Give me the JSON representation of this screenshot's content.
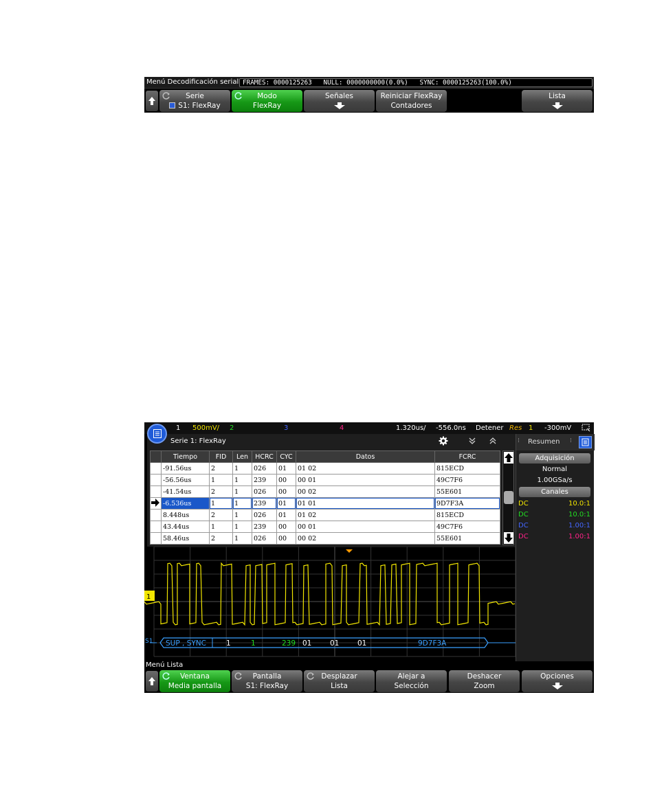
{
  "menu1": {
    "title": "Menú Decodificación serial",
    "stats": "FRAMES: 0000125263   NULL: 0000000000(0.0%)   SYNC: 0000125263(100.0%)",
    "softkeys": [
      {
        "line1": "Serie",
        "line2": "S1: FlexRay"
      },
      {
        "line1": "Modo",
        "line2": "FlexRay"
      },
      {
        "line1": "Señales"
      },
      {
        "line1": "Reiniciar FlexRay",
        "line2": "Contadores"
      },
      {
        "line1": ""
      },
      {
        "line1": "Lista"
      }
    ]
  },
  "statusbar": {
    "ch1": "1",
    "ch1_scale": "500mV/",
    "ch2": "2",
    "ch3": "3",
    "ch4": "4",
    "timebase": "1.320us/",
    "delay": "-556.0ns",
    "run_state": "Detener",
    "trigger_label": "Res",
    "trigger_ch": "1",
    "trigger_level": "-300mV"
  },
  "list": {
    "title": "Serie 1: FlexRay",
    "headers": [
      "Tiempo",
      "FID",
      "Len",
      "HCRC",
      "CYC",
      "Datos",
      "FCRC"
    ],
    "rows": [
      {
        "tiempo": "-91.56us",
        "fid": "2",
        "len": "1",
        "hcrc": "026",
        "cyc": "01",
        "datos": "01 02",
        "fcrc": "815ECD"
      },
      {
        "tiempo": "-56.56us",
        "fid": "1",
        "len": "1",
        "hcrc": "239",
        "cyc": "00",
        "datos": "00 01",
        "fcrc": "49C7F6"
      },
      {
        "tiempo": "-41.54us",
        "fid": "2",
        "len": "1",
        "hcrc": "026",
        "cyc": "00",
        "datos": "00 02",
        "fcrc": "55E601"
      },
      {
        "tiempo": "-6.536us",
        "fid": "1",
        "len": "1",
        "hcrc": "239",
        "cyc": "01",
        "datos": "01 01",
        "fcrc": "9D7F3A"
      },
      {
        "tiempo": "8.448us",
        "fid": "2",
        "len": "1",
        "hcrc": "026",
        "cyc": "01",
        "datos": "01 02",
        "fcrc": "815ECD"
      },
      {
        "tiempo": "43.44us",
        "fid": "1",
        "len": "1",
        "hcrc": "239",
        "cyc": "00",
        "datos": "00 01",
        "fcrc": "49C7F6"
      },
      {
        "tiempo": "58.46us",
        "fid": "2",
        "len": "1",
        "hcrc": "026",
        "cyc": "00",
        "datos": "00 02",
        "fcrc": "55E601"
      }
    ]
  },
  "side": {
    "tab": "Resumen",
    "acq_header": "Adquisición",
    "acq_mode": "Normal",
    "acq_rate": "1.00GSa/s",
    "channels_header": "Canales",
    "channels": [
      {
        "coupling": "DC",
        "probe": "10.0:1",
        "color": "#f2e600"
      },
      {
        "coupling": "DC",
        "probe": "10.0:1",
        "color": "#22dd22"
      },
      {
        "coupling": "DC",
        "probe": "1.00:1",
        "color": "#4466ff"
      },
      {
        "coupling": "DC",
        "probe": "1.00:1",
        "color": "#ff2288"
      }
    ]
  },
  "decode_bus": {
    "label": "S1",
    "fields": [
      "SUP , SYNC",
      "1",
      "1",
      "239",
      "01",
      "01",
      "01",
      "9D7F3A"
    ]
  },
  "ch1_marker": "1",
  "menu2": {
    "title": "Menú Lista",
    "softkeys": [
      {
        "line1": "Ventana",
        "line2": "Media pantalla"
      },
      {
        "line1": "Pantalla",
        "line2": "S1: FlexRay"
      },
      {
        "line1": "Desplazar",
        "line2": "Lista"
      },
      {
        "line1": "Alejar a",
        "line2": "Selección"
      },
      {
        "line1": "Deshacer",
        "line2": "Zoom"
      },
      {
        "line1": "Opciones"
      }
    ]
  },
  "colors": {
    "ch1": "#f2e600",
    "ch2": "#22dd22",
    "ch3": "#4466ff",
    "ch4": "#ff2288",
    "serial": "#3aa0ff",
    "softkey_active": "#169816"
  }
}
